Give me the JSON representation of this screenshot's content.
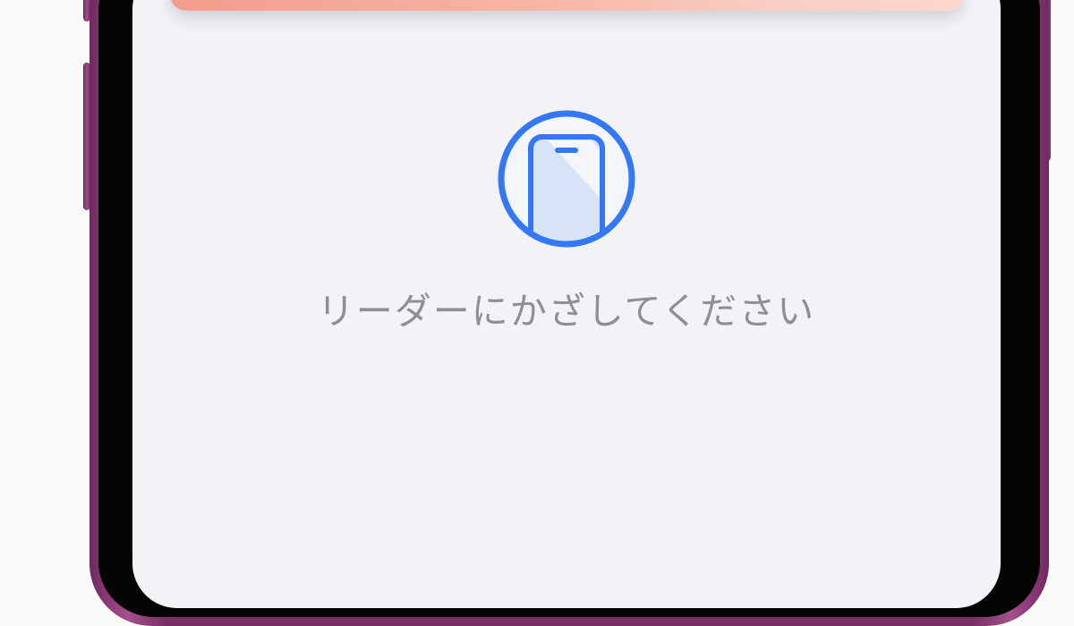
{
  "screen": {
    "instruction": "リーダーにかざしてください",
    "icon": "phone-in-circle-icon",
    "accent_color": "#3478f6"
  },
  "device": {
    "frame_color": "#7a2e66",
    "screen_background": "#f2f2f7"
  },
  "card": {
    "gradient_start": "#f39d8c",
    "gradient_end": "#fbd7cd"
  }
}
